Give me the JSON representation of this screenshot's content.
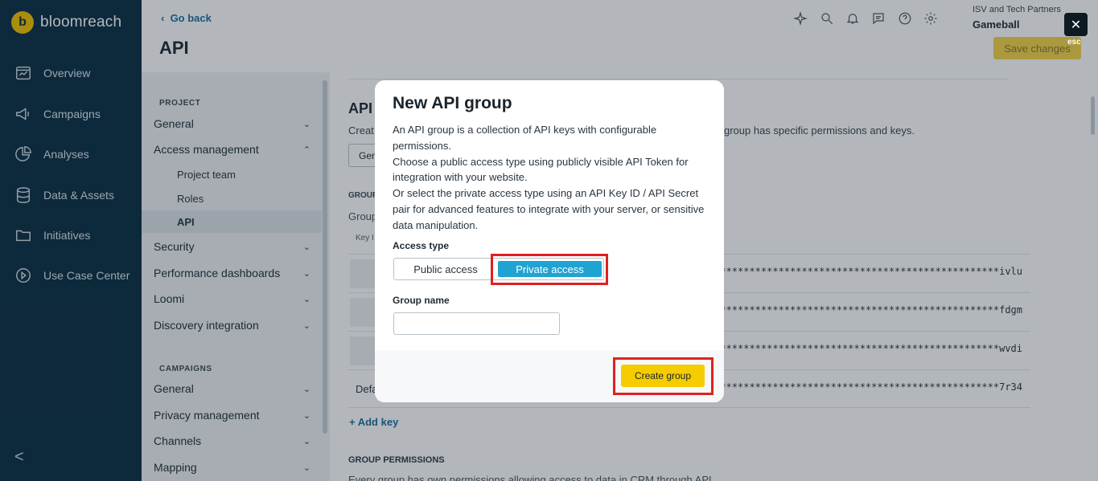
{
  "brand": {
    "name": "bloomreach",
    "logo_letter": "b"
  },
  "leftnav": {
    "items": [
      {
        "label": "Overview",
        "icon": "overview-icon"
      },
      {
        "label": "Campaigns",
        "icon": "megaphone-icon"
      },
      {
        "label": "Analyses",
        "icon": "pie-chart-icon"
      },
      {
        "label": "Data & Assets",
        "icon": "database-icon"
      },
      {
        "label": "Initiatives",
        "icon": "folder-icon"
      },
      {
        "label": "Use Case Center",
        "icon": "play-circle-icon"
      }
    ],
    "collapse_glyph": "<"
  },
  "header": {
    "back_label": "Go back",
    "title": "API",
    "org_subtitle": "ISV and Tech Partners",
    "org_name": "Gameball",
    "save_label": "Save changes"
  },
  "settings": {
    "project_head": "PROJECT",
    "campaigns_head": "CAMPAIGNS",
    "project_items": [
      {
        "label": "General"
      },
      {
        "label": "Access management"
      },
      {
        "label": "Security"
      },
      {
        "label": "Performance dashboards"
      },
      {
        "label": "Loomi"
      },
      {
        "label": "Discovery integration"
      }
    ],
    "access_sub": [
      "Project team",
      "Roles",
      "API"
    ],
    "campaign_items": [
      {
        "label": "General"
      },
      {
        "label": "Privacy management"
      },
      {
        "label": "Channels"
      },
      {
        "label": "Mapping"
      }
    ]
  },
  "main": {
    "title": "API",
    "desc_left": "Creat",
    "desc_right": "group has specific permissions and keys.",
    "gen_btn": "Gen",
    "groups_head": "GROUP",
    "groups_txt": "Group",
    "keyid_head": "Key I",
    "keys": [
      {
        "name": "",
        "masked": "******************************************************ivlu"
      },
      {
        "name": "",
        "masked": "******************************************************fdgm"
      },
      {
        "name": "",
        "masked": "******************************************************wvdi"
      },
      {
        "name": "Defa",
        "masked": "******************************************************7r34"
      }
    ],
    "add_key": "+ Add key",
    "perm_head": "GROUP PERMISSIONS",
    "perm_txt": "Every group has own permissions allowing access to data in CRM through API"
  },
  "overlay": {
    "esc_label": "esc",
    "close_glyph": "✕"
  },
  "modal": {
    "title": "New API group",
    "desc": [
      "An API group is a collection of API keys with configurable permissions.",
      "Choose a public access type using publicly visible API Token for integration with your website.",
      "Or select the private access type using an API Key ID / API Secret pair for advanced features to integrate with your server, or sensitive data manipulation."
    ],
    "access_type_label": "Access type",
    "access_options": [
      "Public access",
      "Private access"
    ],
    "selected_access": "Private access",
    "group_name_label": "Group name",
    "group_name_value": "",
    "create_label": "Create group"
  },
  "colors": {
    "nav_bg": "#0b2f45",
    "accent": "#1fa3d3",
    "primary_btn": "#f5cc00",
    "highlight": "#e02020"
  }
}
